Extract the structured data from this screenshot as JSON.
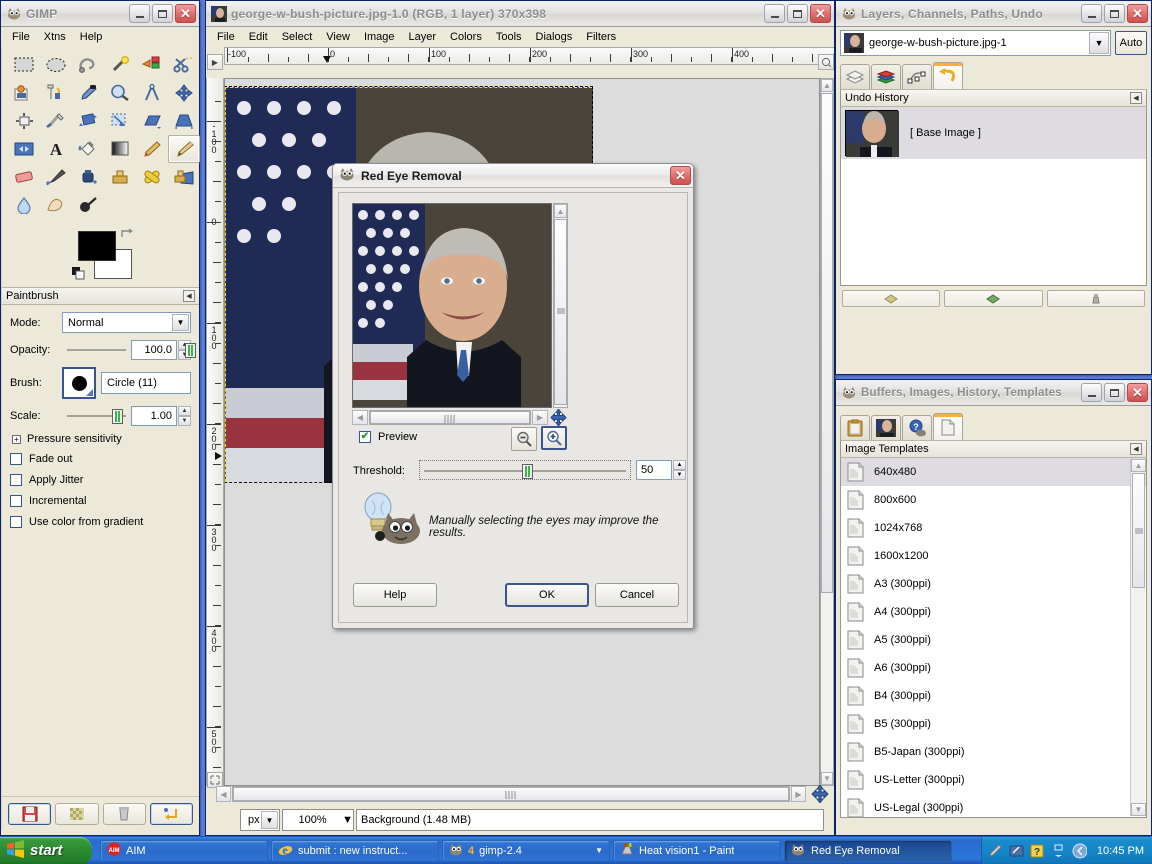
{
  "toolbox": {
    "title": "GIMP",
    "menu": [
      "File",
      "Xtns",
      "Help"
    ],
    "tools": [
      "rect-select-tool",
      "ellipse-select-tool",
      "free-select-tool",
      "fuzzy-select-tool",
      "select-by-color-tool",
      "scissors-select-tool",
      "foreground-select-tool",
      "paths-tool",
      "color-picker-tool",
      "zoom-tool",
      "measure-tool",
      "move-tool",
      "align-tool",
      "crop-tool",
      "rotate-tool",
      "scale-tool",
      "shear-tool",
      "perspective-tool",
      "flip-tool",
      "text-tool",
      "bucket-fill-tool",
      "blend-tool",
      "pencil-tool",
      "paintbrush-tool",
      "eraser-tool",
      "airbrush-tool",
      "ink-tool",
      "clone-tool",
      "heal-tool",
      "perspective-clone-tool",
      "blur-sharpen-tool",
      "smudge-tool",
      "dodge-burn-tool"
    ],
    "active_tool_index": 23,
    "colors": {
      "foreground": "#000000",
      "background": "#ffffff"
    },
    "options": {
      "panel_title": "Paintbrush",
      "mode_label": "Mode:",
      "mode_value": "Normal",
      "opacity_label": "Opacity:",
      "opacity_value": "100.0",
      "brush_label": "Brush:",
      "brush_value": "Circle (11)",
      "scale_label": "Scale:",
      "scale_value": "1.00",
      "pressure_sensitivity": "Pressure sensitivity",
      "checkboxes": [
        {
          "label": "Fade out",
          "checked": false
        },
        {
          "label": "Apply Jitter",
          "checked": false
        },
        {
          "label": "Incremental",
          "checked": false
        },
        {
          "label": "Use color from gradient",
          "checked": false
        }
      ]
    },
    "footer_buttons": [
      "save-tool-options-icon",
      "restore-tool-options-icon",
      "delete-tool-options-icon",
      "reset-tool-options-icon"
    ]
  },
  "image_window": {
    "title": "george-w-bush-picture.jpg-1.0 (RGB, 1 layer) 370x398",
    "menu": [
      "File",
      "Edit",
      "Select",
      "View",
      "Image",
      "Layer",
      "Colors",
      "Tools",
      "Dialogs",
      "Filters"
    ],
    "ruler_h_labels": [
      "-100",
      "0",
      "100",
      "200",
      "300",
      "400"
    ],
    "ruler_v_labels": [
      "-100",
      "0",
      "100",
      "200",
      "300",
      "400",
      "500"
    ],
    "status": {
      "unit": "px",
      "zoom": "100%",
      "message": "Background (1.48 MB)"
    }
  },
  "dock_layers": {
    "title": "Layers, Channels, Paths, Undo",
    "image_name": "george-w-bush-picture.jpg-1",
    "auto_button": "Auto",
    "tabs": [
      "layers-tab-icon",
      "channels-tab-icon",
      "paths-tab-icon",
      "undo-history-tab-icon"
    ],
    "active_tab_index": 3,
    "panel_title": "Undo History",
    "items": [
      {
        "label": "[ Base Image ]",
        "selected": true
      }
    ],
    "bottom_buttons": [
      "undo-button-icon",
      "redo-button-icon",
      "clear-undo-history-icon"
    ]
  },
  "dock_templates": {
    "title": "Buffers, Images, History, Templates",
    "tabs": [
      "buffers-tab-icon",
      "images-tab-icon",
      "document-history-tab-icon",
      "templates-tab-icon"
    ],
    "active_tab_index": 3,
    "panel_title": "Image Templates",
    "items": [
      {
        "label": "640x480",
        "selected": true
      },
      {
        "label": "800x600",
        "selected": false
      },
      {
        "label": "1024x768",
        "selected": false
      },
      {
        "label": "1600x1200",
        "selected": false
      },
      {
        "label": "A3 (300ppi)",
        "selected": false
      },
      {
        "label": "A4 (300ppi)",
        "selected": false
      },
      {
        "label": "A5 (300ppi)",
        "selected": false
      },
      {
        "label": "A6 (300ppi)",
        "selected": false
      },
      {
        "label": "B4 (300ppi)",
        "selected": false
      },
      {
        "label": "B5 (300ppi)",
        "selected": false
      },
      {
        "label": "B5-Japan (300ppi)",
        "selected": false
      },
      {
        "label": "US-Letter (300ppi)",
        "selected": false
      },
      {
        "label": "US-Legal (300ppi)",
        "selected": false
      }
    ]
  },
  "red_eye_dialog": {
    "title": "Red Eye Removal",
    "preview_label": "Preview",
    "preview_checked": true,
    "zoom_out_icon": "zoom-out-icon",
    "zoom_in_icon": "zoom-in-icon",
    "threshold_label": "Threshold:",
    "threshold_value": "50",
    "hint": "Manually selecting the eyes may improve the results.",
    "buttons": {
      "help": "Help",
      "ok": "OK",
      "cancel": "Cancel"
    }
  },
  "taskbar": {
    "start_label": "start",
    "tasks": [
      {
        "label": "AIM",
        "icon": "aim-icon",
        "count": "",
        "active": false
      },
      {
        "label": "submit : new instruct...",
        "icon": "internet-explorer-icon",
        "count": "",
        "active": false
      },
      {
        "label": "gimp-2.4",
        "icon": "gimp-icon",
        "count": "4",
        "active": false
      },
      {
        "label": "Heat vision1 - Paint",
        "icon": "paint-icon",
        "count": "",
        "active": false
      },
      {
        "label": "Red Eye Removal",
        "icon": "gimp-icon",
        "count": "",
        "active": true
      }
    ],
    "tray_icons": [
      "pen-tray-icon",
      "tablet-tray-icon",
      "help-tray-icon",
      "chevron-tray-icon"
    ],
    "clock": "10:45 PM"
  }
}
